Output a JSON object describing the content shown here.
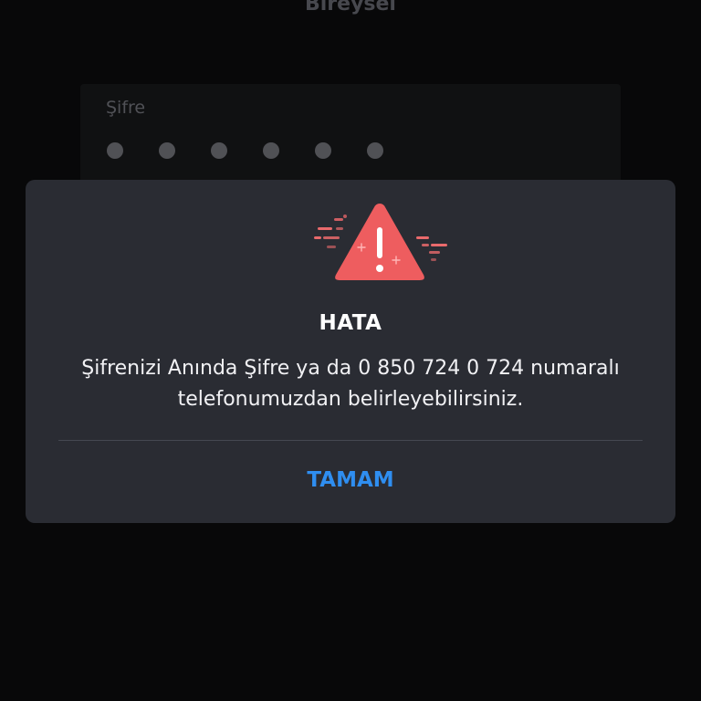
{
  "background": {
    "tab_label": "Bireysel",
    "password_label": "Şifre",
    "password_length": 6
  },
  "dialog": {
    "icon": "warning-triangle-icon",
    "title": "HATA",
    "message_line1": "Şifrenizi Anında Şifre ya da 0 850 724 0 724 numaralı",
    "message_line2": "telefonumuzdan belirleyebilirsiniz.",
    "ok_label": "TAMAM"
  },
  "colors": {
    "accent": "#2f8ef0",
    "warning": "#ee5d5f",
    "dialog_bg": "#2a2c33"
  }
}
